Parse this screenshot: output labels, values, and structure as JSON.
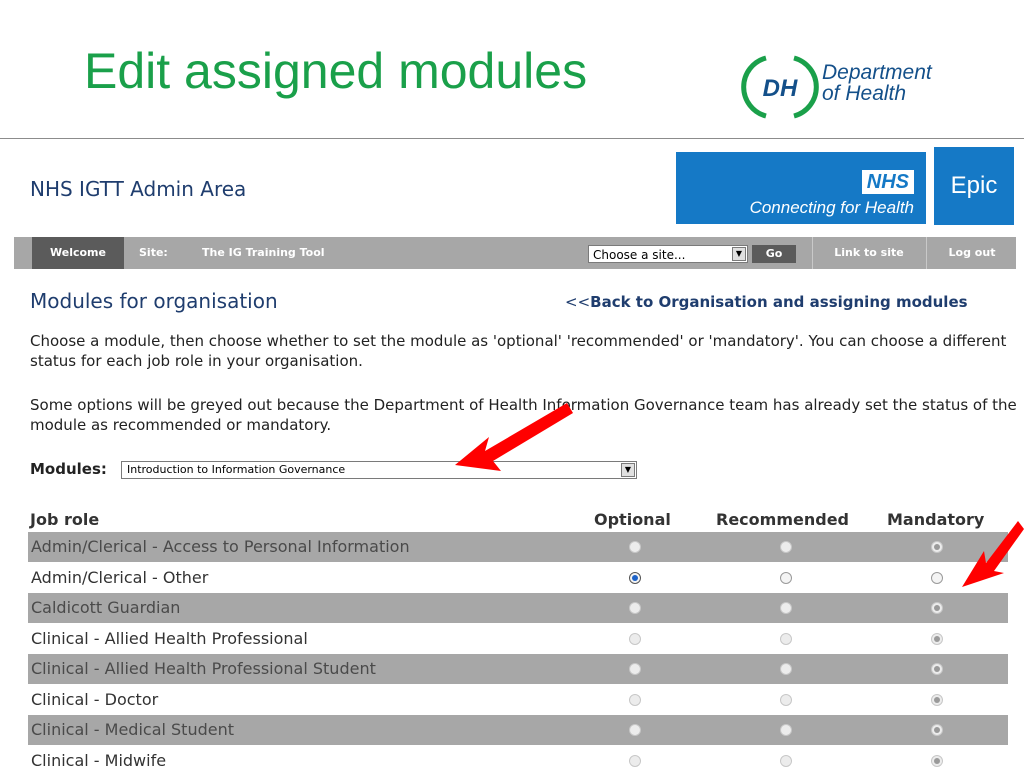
{
  "slide": {
    "title": "Edit assigned modules",
    "logo_mark": "DH",
    "logo_line1": "Department",
    "logo_line2": "of Health"
  },
  "app": {
    "title": "NHS IGTT Admin Area",
    "nhs_badge": "NHS",
    "cfh_text": "Connecting for Health",
    "epic_text": "Epic"
  },
  "nav": {
    "welcome": "Welcome",
    "site_label": "Site:",
    "site_name": "The IG Training Tool",
    "site_select_value": "Choose a site...",
    "go_label": "Go",
    "link_to_site": "Link to site",
    "logout": "Log out"
  },
  "main": {
    "heading": "Modules for organisation",
    "back_prefix": "<<",
    "back_link": "Back to Organisation and assigning modules",
    "para1": "Choose a module, then choose whether to set the module as 'optional' 'recommended' or 'mandatory'. You can choose a different status for each job role in your organisation.",
    "para2": "Some options will be greyed out because the Department of Health Information Governance team has already set the status of the module as recommended or mandatory.",
    "modules_label": "Modules:",
    "module_selected": "Introduction to Information Governance"
  },
  "table": {
    "headers": {
      "role": "Job role",
      "optional": "Optional",
      "recommended": "Recommended",
      "mandatory": "Mandatory"
    },
    "rows": [
      {
        "role": "Admin/Clerical - Access to Personal Information",
        "selected": "mandatory",
        "locked": true
      },
      {
        "role": "Admin/Clerical - Other",
        "selected": "optional",
        "locked": false
      },
      {
        "role": "Caldicott Guardian",
        "selected": "mandatory",
        "locked": true
      },
      {
        "role": "Clinical - Allied Health Professional",
        "selected": "mandatory",
        "locked": true
      },
      {
        "role": "Clinical - Allied Health Professional Student",
        "selected": "mandatory",
        "locked": true
      },
      {
        "role": "Clinical - Doctor",
        "selected": "mandatory",
        "locked": true
      },
      {
        "role": "Clinical - Medical Student",
        "selected": "mandatory",
        "locked": true
      },
      {
        "role": "Clinical - Midwife",
        "selected": "mandatory",
        "locked": true
      }
    ]
  },
  "colors": {
    "slide_title": "#1aa04a",
    "app_title": "#1f3d6e",
    "nhs_blue": "#1579c6",
    "nav_bar": "#a7a7a7",
    "annotation_arrow": "#ff0000"
  }
}
